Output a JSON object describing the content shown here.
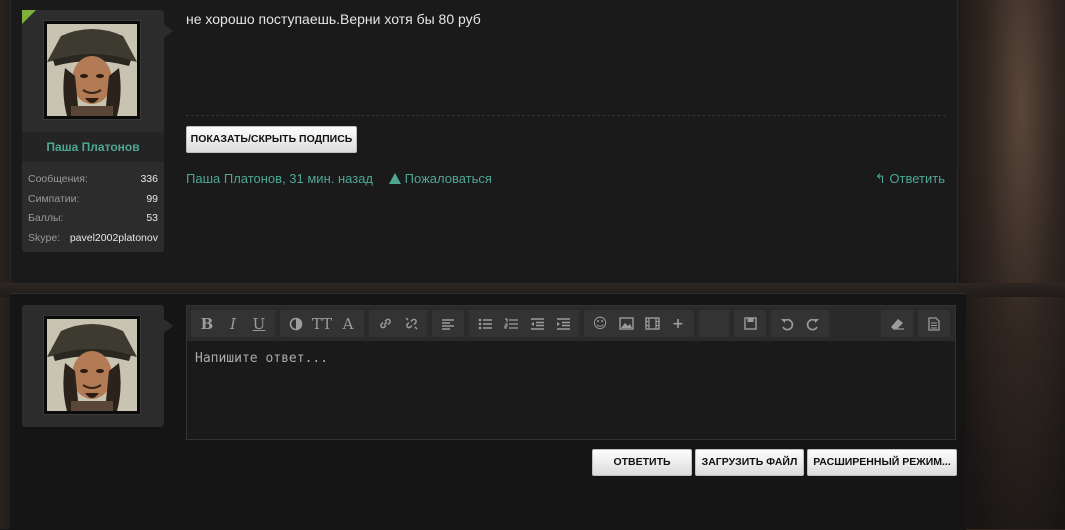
{
  "post": {
    "author": "Паша Платонов",
    "stats": [
      {
        "label": "Сообщения:",
        "value": "336"
      },
      {
        "label": "Симпатии:",
        "value": "99"
      },
      {
        "label": "Баллы:",
        "value": "53"
      },
      {
        "label": "Skype:",
        "value": "pavel2002platonov"
      }
    ],
    "message": "не хорошо поступаешь.Верни хотя бы 80 руб",
    "signature_toggle_label": "ПОКАЗАТЬ/СКРЫТЬ ПОДПИСЬ",
    "meta_author_time": "Паша Платонов, 31 мин. назад",
    "report_label": "Пожаловаться",
    "reply_link_label": "Ответить"
  },
  "colors": {
    "accent": "#4ea792",
    "new_post_corner": "#7fb13a"
  },
  "editor": {
    "placeholder": "Напишите ответ...",
    "toolbar": {
      "bold": "B",
      "italic": "I",
      "underline": "U",
      "font_size": "TT",
      "font_family": "A",
      "smilie": "☺",
      "more": "+"
    }
  },
  "actions": {
    "reply_label": "ОТВЕТИТЬ",
    "upload_label": "ЗАГРУЗИТЬ ФАЙЛ",
    "advanced_label": "РАСШИРЕННЫЙ РЕЖИМ..."
  }
}
